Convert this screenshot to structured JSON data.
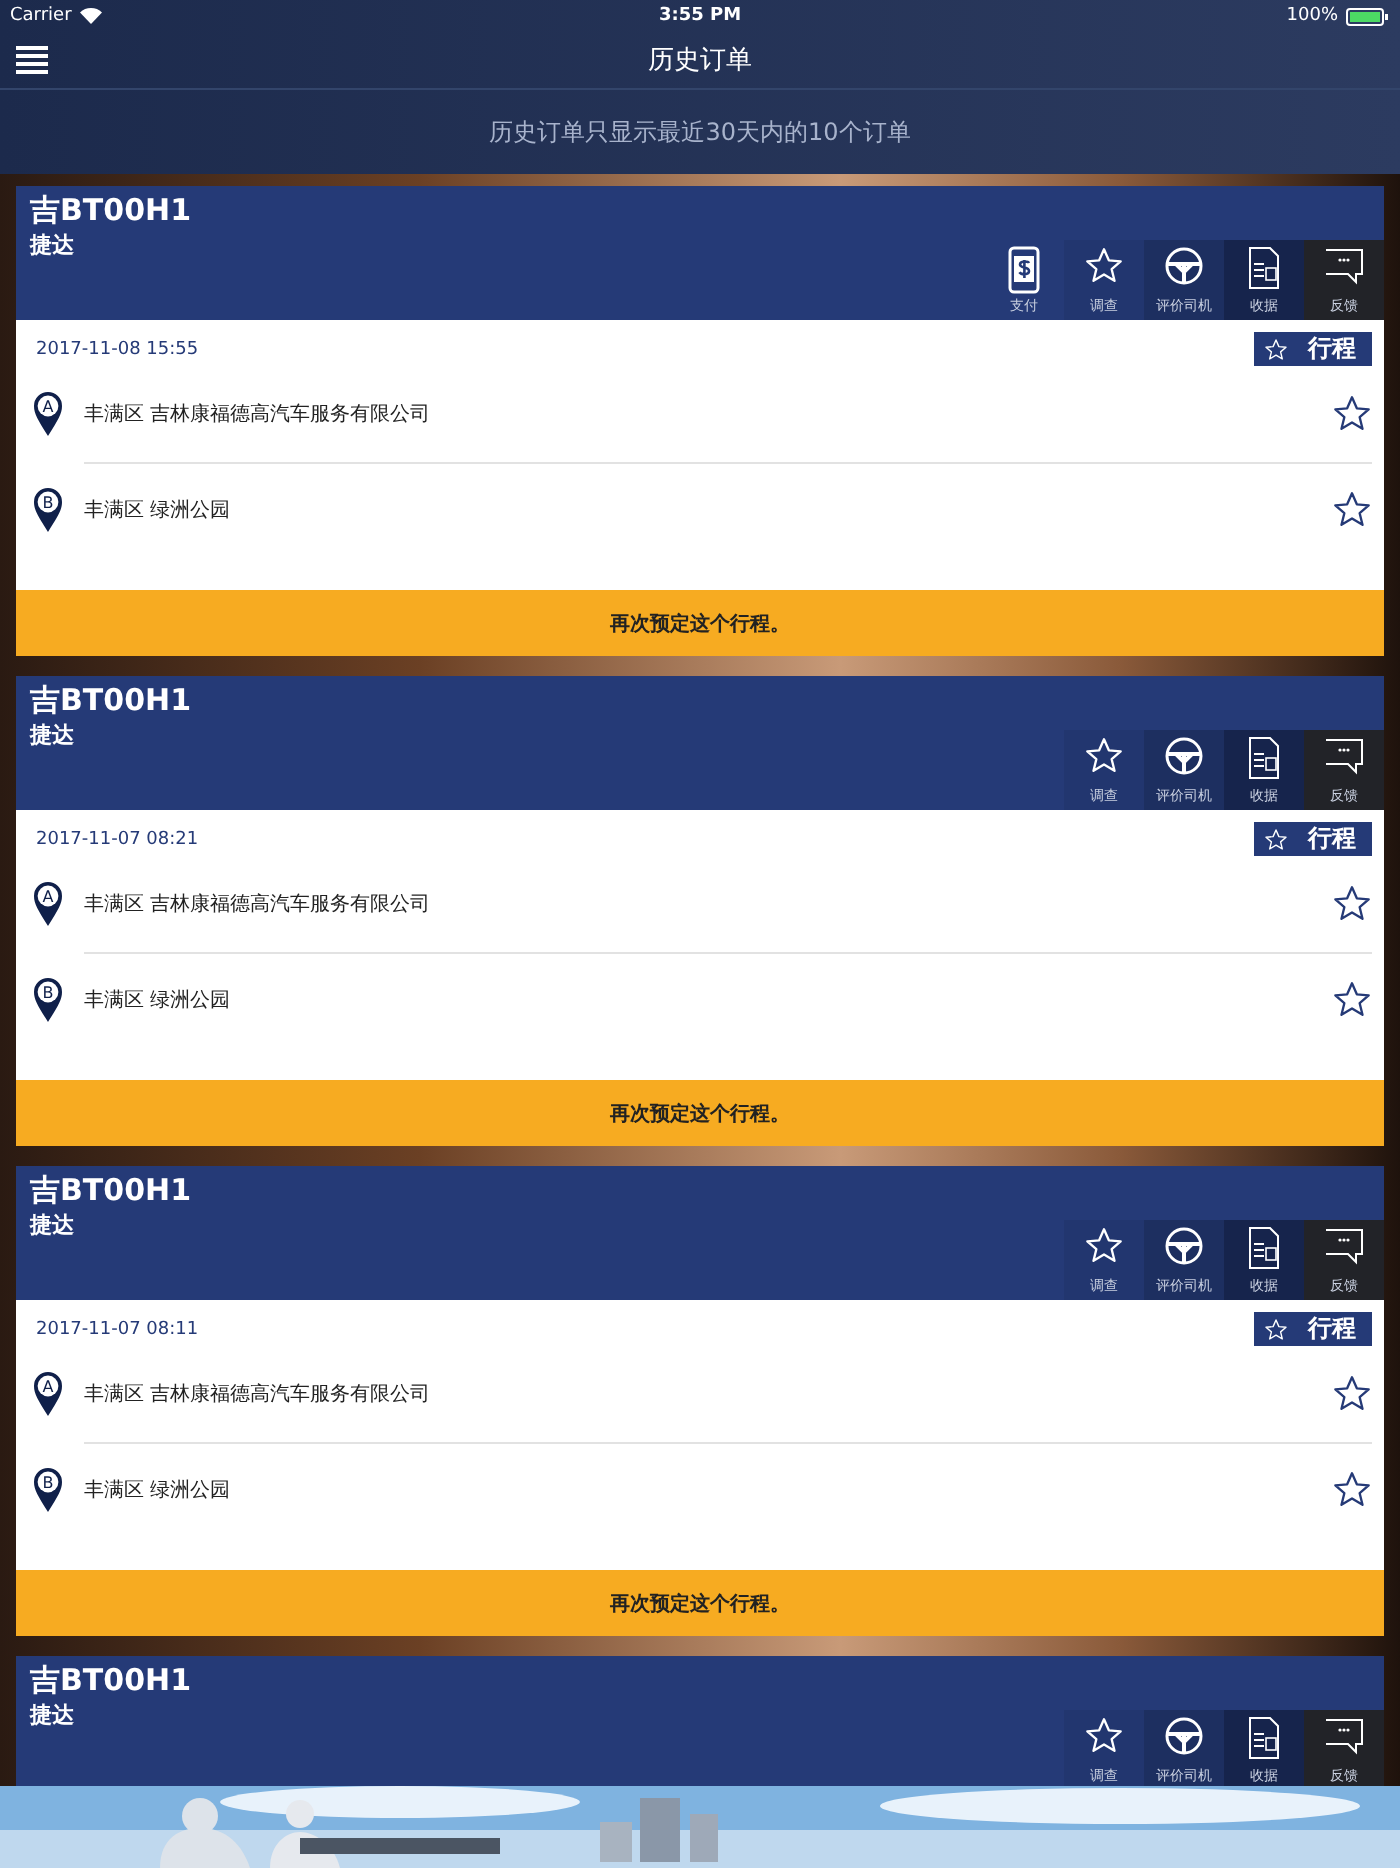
{
  "status_bar": {
    "carrier": "Carrier",
    "time": "3:55 PM",
    "battery": "100%"
  },
  "nav": {
    "title": "历史订单"
  },
  "notice": "历史订单只显示最近30天内的10个订单",
  "orders": [
    {
      "plate": "吉BT00H1",
      "model": "捷达",
      "actions": [
        {
          "kind": "pay",
          "label": "支付"
        },
        {
          "kind": "survey",
          "label": "调查"
        },
        {
          "kind": "rate",
          "label": "评价司机"
        },
        {
          "kind": "receipt",
          "label": "收据"
        },
        {
          "kind": "feedback",
          "label": "反馈"
        }
      ],
      "datetime": "2017-11-08 15:55",
      "trip_label": "行程",
      "stops": [
        {
          "marker": "A",
          "address": "丰满区 吉林康福德高汽车服务有限公司"
        },
        {
          "marker": "B",
          "address": "丰满区 绿洲公园"
        }
      ],
      "rebook": "再次预定这个行程。"
    },
    {
      "plate": "吉BT00H1",
      "model": "捷达",
      "actions": [
        {
          "kind": "survey",
          "label": "调查"
        },
        {
          "kind": "rate",
          "label": "评价司机"
        },
        {
          "kind": "receipt",
          "label": "收据"
        },
        {
          "kind": "feedback",
          "label": "反馈"
        }
      ],
      "datetime": "2017-11-07 08:21",
      "trip_label": "行程",
      "stops": [
        {
          "marker": "A",
          "address": "丰满区 吉林康福德高汽车服务有限公司"
        },
        {
          "marker": "B",
          "address": "丰满区 绿洲公园"
        }
      ],
      "rebook": "再次预定这个行程。"
    },
    {
      "plate": "吉BT00H1",
      "model": "捷达",
      "actions": [
        {
          "kind": "survey",
          "label": "调查"
        },
        {
          "kind": "rate",
          "label": "评价司机"
        },
        {
          "kind": "receipt",
          "label": "收据"
        },
        {
          "kind": "feedback",
          "label": "反馈"
        }
      ],
      "datetime": "2017-11-07 08:11",
      "trip_label": "行程",
      "stops": [
        {
          "marker": "A",
          "address": "丰满区 吉林康福德高汽车服务有限公司"
        },
        {
          "marker": "B",
          "address": "丰满区 绿洲公园"
        }
      ],
      "rebook": "再次预定这个行程。"
    },
    {
      "plate": "吉BT00H1",
      "model": "捷达",
      "actions": [
        {
          "kind": "survey",
          "label": "调查"
        },
        {
          "kind": "rate",
          "label": "评价司机"
        },
        {
          "kind": "receipt",
          "label": "收据"
        },
        {
          "kind": "feedback",
          "label": "反馈"
        }
      ]
    }
  ]
}
